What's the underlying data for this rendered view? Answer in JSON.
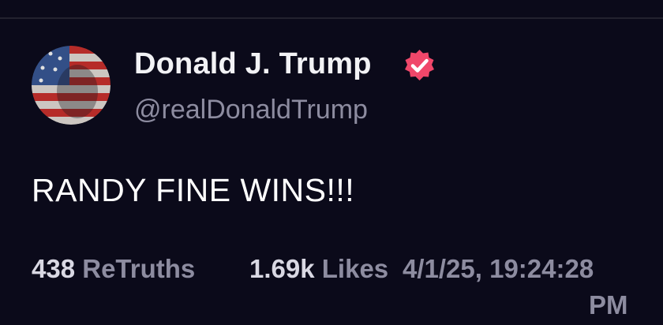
{
  "post": {
    "author": {
      "display_name": "Donald J. Trump",
      "handle": "@realDonaldTrump",
      "verified": true,
      "verified_badge_color": "#f0476a",
      "avatar_icon": "avatar-flag-portrait"
    },
    "text": "RANDY FINE WINS!!!",
    "stats": {
      "retruths_count": "438",
      "retruths_label": "ReTruths",
      "likes_count": "1.69k",
      "likes_label": "Likes",
      "timestamp_line1": "4/1/25, 19:24:28",
      "timestamp_line2": "PM"
    }
  },
  "theme": {
    "background": "#0b0a1a",
    "muted_text": "#8d8ca0",
    "primary_text": "#ffffff"
  }
}
